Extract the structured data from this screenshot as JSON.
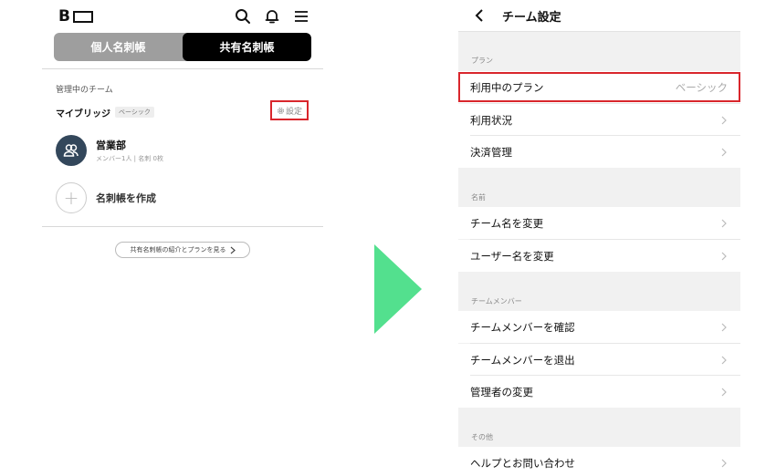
{
  "left_screen": {
    "logo_text": "B",
    "segment": {
      "personal": "個人名刺帳",
      "shared": "共有名刺帳",
      "active": "shared"
    },
    "section_label": "管理中のチーム",
    "team": {
      "name": "マイブリッジ",
      "plan_badge": "ベーシック",
      "settings_label": "設定"
    },
    "notebook": {
      "title": "営業部",
      "subtitle": "メンバー1人 | 名刺 0枚"
    },
    "create_label": "名刺帳を作成",
    "intro_link": "共有名刺帳の紹介とプランを見る",
    "highlight_color": "#d9262c"
  },
  "arrow_color": "#53e08e",
  "right_screen": {
    "title": "チーム設定",
    "groups": [
      {
        "label": "プラン",
        "rows": [
          {
            "label": "利用中のプラン",
            "value": "ベーシック",
            "highlighted": true
          },
          {
            "label": "利用状況"
          },
          {
            "label": "決済管理"
          }
        ]
      },
      {
        "label": "名前",
        "rows": [
          {
            "label": "チーム名を変更"
          },
          {
            "label": "ユーザー名を変更"
          }
        ]
      },
      {
        "label": "チームメンバー",
        "rows": [
          {
            "label": "チームメンバーを確認"
          },
          {
            "label": "チームメンバーを退出"
          },
          {
            "label": "管理者の変更"
          }
        ]
      },
      {
        "label": "その他",
        "rows": [
          {
            "label": "ヘルプとお問い合わせ"
          }
        ]
      }
    ]
  }
}
